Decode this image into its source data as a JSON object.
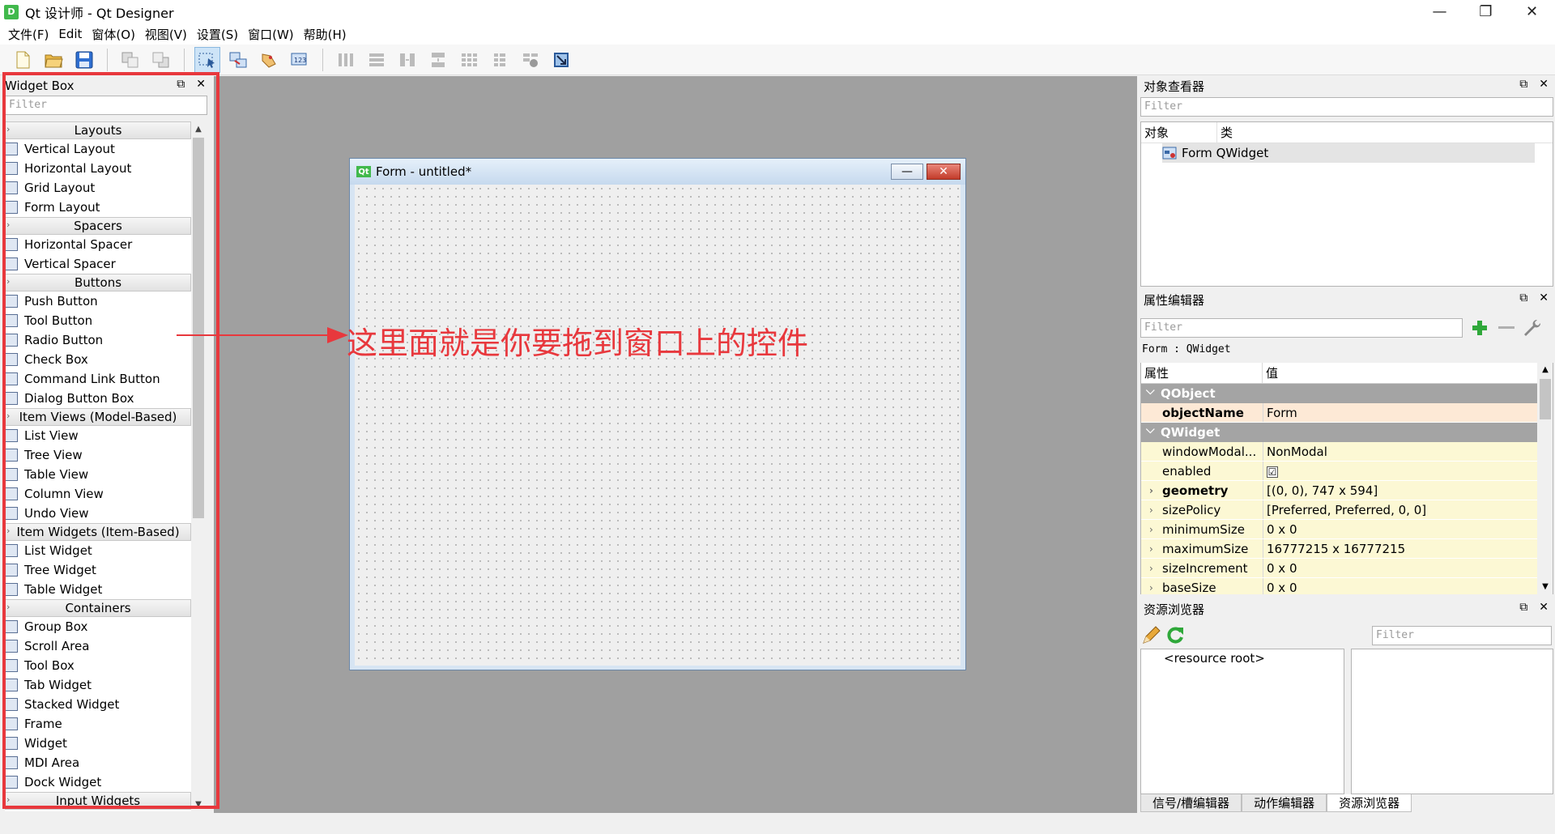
{
  "window": {
    "app_icon": "D",
    "title": "Qt 设计师 - Qt Designer",
    "minimize": "—",
    "restore": "❐",
    "close": "✕"
  },
  "menu": [
    "文件(F)",
    "Edit",
    "窗体(O)",
    "视图(V)",
    "设置(S)",
    "窗口(W)",
    "帮助(H)"
  ],
  "widget_box": {
    "title": "Widget Box",
    "filter_placeholder": "Filter",
    "categories": [
      {
        "name": "Layouts",
        "items": [
          "Vertical Layout",
          "Horizontal Layout",
          "Grid Layout",
          "Form Layout"
        ]
      },
      {
        "name": "Spacers",
        "items": [
          "Horizontal Spacer",
          "Vertical Spacer"
        ]
      },
      {
        "name": "Buttons",
        "items": [
          "Push Button",
          "Tool Button",
          "Radio Button",
          "Check Box",
          "Command Link Button",
          "Dialog Button Box"
        ]
      },
      {
        "name": "Item Views (Model-Based)",
        "items": [
          "List View",
          "Tree View",
          "Table View",
          "Column View",
          "Undo View"
        ]
      },
      {
        "name": "Item Widgets (Item-Based)",
        "items": [
          "List Widget",
          "Tree Widget",
          "Table Widget"
        ]
      },
      {
        "name": "Containers",
        "items": [
          "Group Box",
          "Scroll Area",
          "Tool Box",
          "Tab Widget",
          "Stacked Widget",
          "Frame",
          "Widget",
          "MDI Area",
          "Dock Widget"
        ]
      },
      {
        "name": "Input Widgets",
        "items": []
      }
    ]
  },
  "form": {
    "badge": "Qt",
    "title": "Form - untitled*"
  },
  "annotation": {
    "text": "这里面就是你要拖到窗口上的控件",
    "color": "#e8383d"
  },
  "object_inspector": {
    "title": "对象查看器",
    "filter_placeholder": "Filter",
    "col_object": "对象",
    "col_class": "类",
    "row": {
      "object": "Form",
      "class": "QWidget"
    }
  },
  "property_editor": {
    "title": "属性编辑器",
    "filter_placeholder": "Filter",
    "context": "Form : QWidget",
    "col_property": "属性",
    "col_value": "值",
    "rows": [
      {
        "type": "group",
        "name": "QObject"
      },
      {
        "type": "prop",
        "name": "objectName",
        "value": "Form",
        "bold": true,
        "bg": "#fde9d6"
      },
      {
        "type": "group",
        "name": "QWidget"
      },
      {
        "type": "prop",
        "name": "windowModal...",
        "value": "NonModal",
        "bg": "#fcf8d4"
      },
      {
        "type": "prop",
        "name": "enabled",
        "value": "☑",
        "bg": "#fcf8d4",
        "checkbox": true
      },
      {
        "type": "prop",
        "name": "geometry",
        "value": "[(0, 0), 747 x 594]",
        "bold": true,
        "expandable": true,
        "bg": "#fcf8d4"
      },
      {
        "type": "prop",
        "name": "sizePolicy",
        "value": "[Preferred, Preferred, 0, 0]",
        "expandable": true,
        "bg": "#fcf8d4"
      },
      {
        "type": "prop",
        "name": "minimumSize",
        "value": "0 x 0",
        "expandable": true,
        "bg": "#fcf8d4"
      },
      {
        "type": "prop",
        "name": "maximumSize",
        "value": "16777215 x 16777215",
        "expandable": true,
        "bg": "#fcf8d4"
      },
      {
        "type": "prop",
        "name": "sizeIncrement",
        "value": "0 x 0",
        "expandable": true,
        "bg": "#fcf8d4"
      },
      {
        "type": "prop",
        "name": "baseSize",
        "value": "0 x 0",
        "expandable": true,
        "bg": "#fcf8d4"
      }
    ]
  },
  "resource_browser": {
    "title": "资源浏览器",
    "filter_placeholder": "Filter",
    "root": "<resource root>"
  },
  "bottom_tabs": [
    "信号/槽编辑器",
    "动作编辑器",
    "资源浏览器"
  ]
}
